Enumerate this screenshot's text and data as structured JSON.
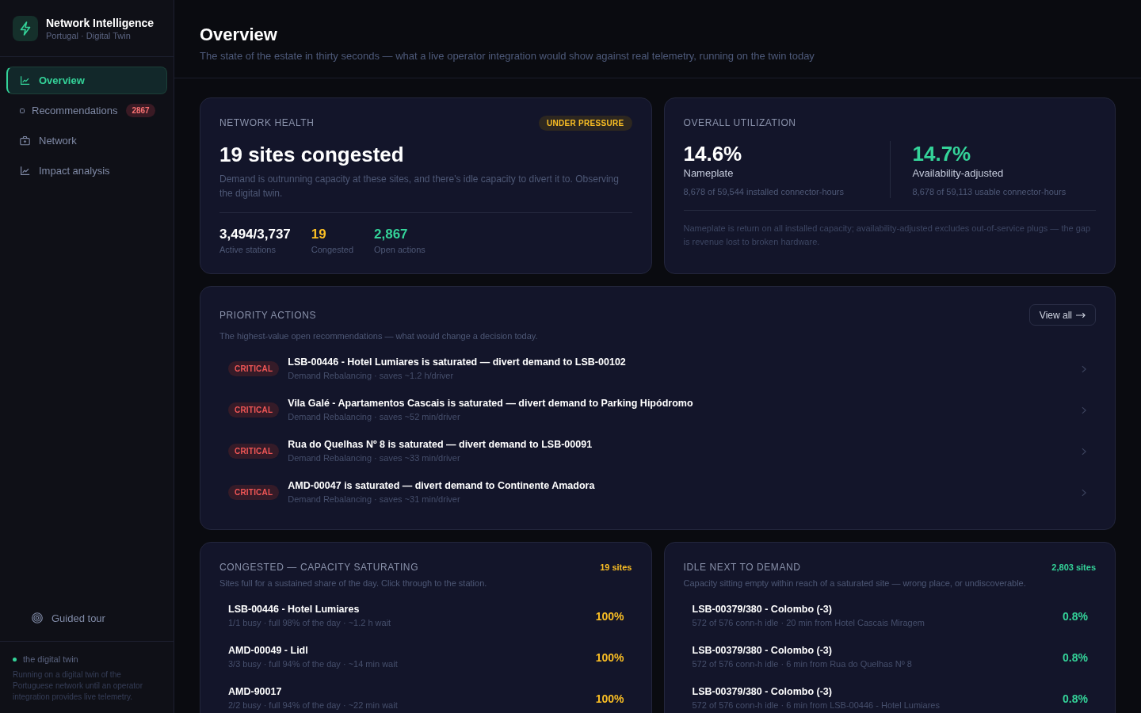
{
  "sidebar": {
    "brand": {
      "title": "Network Intelligence",
      "subtitle": "Portugal · Digital Twin"
    },
    "nav": [
      {
        "label": "Overview",
        "selected": true
      },
      {
        "label": "Recommendations",
        "selected": false,
        "badge": "2867"
      },
      {
        "label": "Network",
        "selected": false
      },
      {
        "label": "Impact analysis",
        "selected": false
      }
    ],
    "guided_tour": "Guided tour",
    "status": {
      "label": "the digital twin",
      "text": "Running on a digital twin of the Portuguese network until an operator integration provides live telemetry."
    }
  },
  "header": {
    "title": "Overview",
    "subtitle": "The state of the estate in thirty seconds — what a live operator integration would show against real telemetry, running on the twin today"
  },
  "network_health": {
    "label": "NETWORK HEALTH",
    "badge": "UNDER PRESSURE",
    "headline": "19 sites congested",
    "description": "Demand is outrunning capacity at these sites, and there's idle capacity to divert it to. Observing the digital twin.",
    "stats": [
      {
        "value": "3,494/3,737",
        "label": "Active stations",
        "color": "#ffffff"
      },
      {
        "value": "19",
        "label": "Congested",
        "color": "#fbbf24"
      },
      {
        "value": "2,867",
        "label": "Open actions",
        "color": "#34d399"
      }
    ]
  },
  "utilization": {
    "label": "OVERALL UTILIZATION",
    "metrics": [
      {
        "value": "14.6%",
        "label": "Nameplate",
        "detail": "8,678 of 59,544 installed connector-hours",
        "color": "#ffffff"
      },
      {
        "value": "14.7%",
        "label": "Availability-adjusted",
        "detail": "8,678 of 59,113 usable connector-hours",
        "color": "#34d399"
      }
    ],
    "note": "Nameplate is return on all installed capacity; availability-adjusted excludes out-of-service plugs — the gap is revenue lost to broken hardware."
  },
  "priority_actions": {
    "label": "PRIORITY ACTIONS",
    "subtitle": "The highest-value open recommendations — what would change a decision today.",
    "view_all": "View all",
    "items": [
      {
        "badge": "CRITICAL",
        "title": "LSB-00446 - Hotel Lumiares is saturated — divert demand to LSB-00102",
        "detail": "Demand Rebalancing · saves ~1.2 h/driver"
      },
      {
        "badge": "CRITICAL",
        "title": "Vila Galé - Apartamentos Cascais is saturated — divert demand to Parking Hipódromo",
        "detail": "Demand Rebalancing · saves ~52 min/driver"
      },
      {
        "badge": "CRITICAL",
        "title": "Rua do Quelhas Nº 8 is saturated — divert demand to LSB-00091",
        "detail": "Demand Rebalancing · saves ~33 min/driver"
      },
      {
        "badge": "CRITICAL",
        "title": "AMD-00047 is saturated — divert demand to Continente Amadora",
        "detail": "Demand Rebalancing · saves ~31 min/driver"
      }
    ]
  },
  "panels": [
    {
      "title": "CONGESTED — CAPACITY SATURATING",
      "count": "19 sites",
      "color": "#fbbf24",
      "subtitle": "Sites full for a sustained share of the day. Click through to the station.",
      "rows": [
        {
          "name": "LSB-00446 - Hotel Lumiares",
          "detail": "1/1 busy · full 98% of the day · ~1.2 h wait",
          "value": "100%"
        },
        {
          "name": "AMD-00049 - Lidl",
          "detail": "3/3 busy · full 94% of the day · ~14 min wait",
          "value": "100%"
        },
        {
          "name": "AMD-90017",
          "detail": "2/2 busy · full 94% of the day · ~22 min wait",
          "value": "100%"
        }
      ]
    },
    {
      "title": "IDLE NEXT TO DEMAND",
      "count": "2,803 sites",
      "color": "#34d399",
      "subtitle": "Capacity sitting empty within reach of a saturated site — wrong place, or undiscoverable.",
      "rows": [
        {
          "name": "LSB-00379/380 - Colombo (-3)",
          "detail": "572 of 576 conn-h idle · 20 min from Hotel Cascais Miragem",
          "value": "0.8%"
        },
        {
          "name": "LSB-00379/380 - Colombo (-3)",
          "detail": "572 of 576 conn-h idle · 6 min from Rua do Quelhas Nº 8",
          "value": "0.8%"
        },
        {
          "name": "LSB-00379/380 - Colombo (-3)",
          "detail": "572 of 576 conn-h idle · 6 min from LSB-00446 - Hotel Lumiares",
          "value": "0.8%"
        }
      ]
    }
  ]
}
